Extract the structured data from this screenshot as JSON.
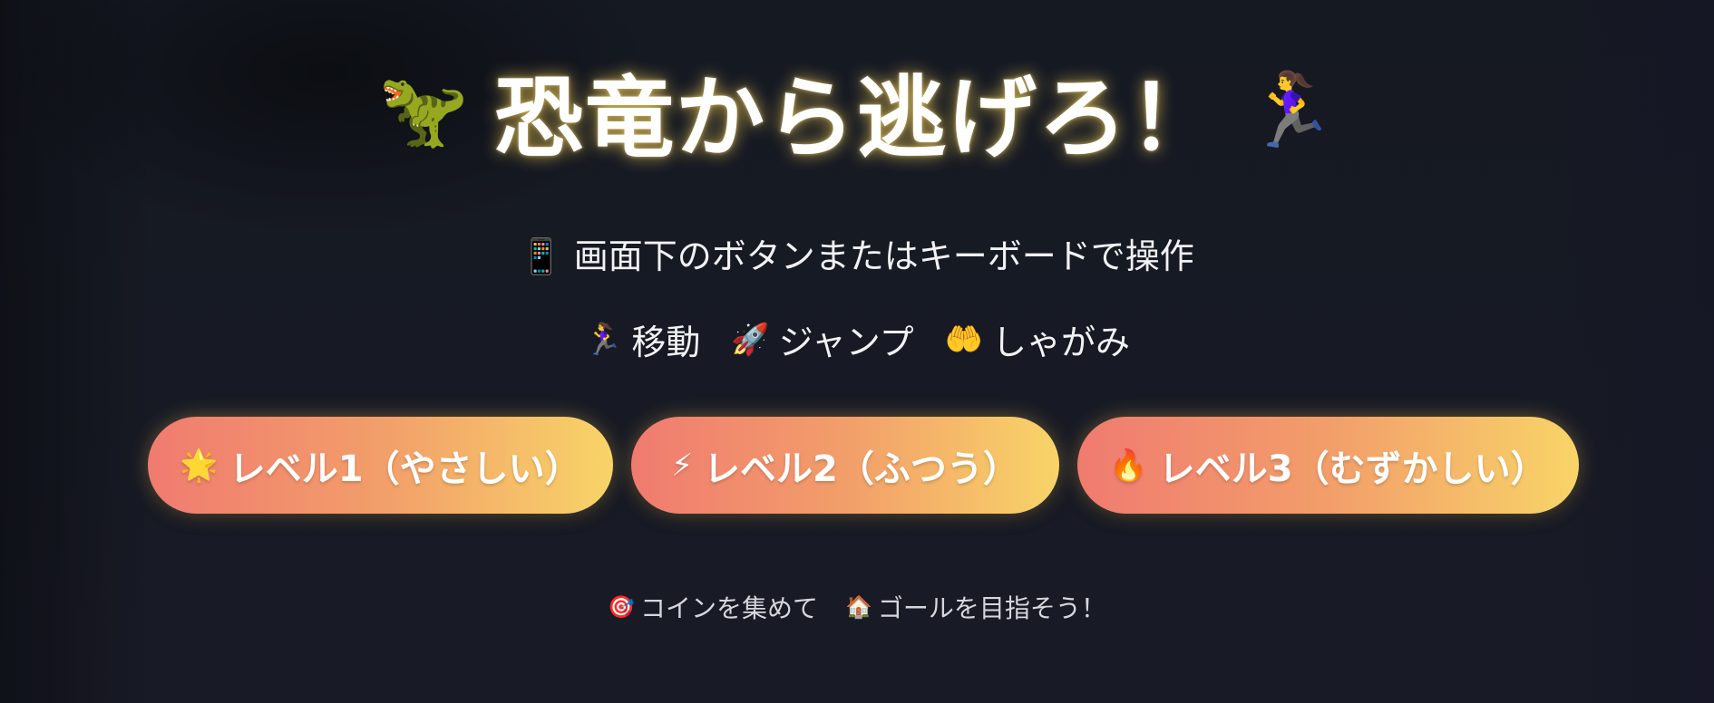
{
  "title": {
    "left_emoji": "🦖",
    "text": "恐竜から逃げろ！",
    "right_emoji": "🏃‍♀️"
  },
  "subtitle": "📱 画面下のボタンまたはキーボードで操作",
  "controls": [
    {
      "icon": "🏃‍♀️",
      "label": "移動"
    },
    {
      "icon": "🚀",
      "label": "ジャンプ"
    },
    {
      "icon": "🤲",
      "label": "しゃがみ"
    }
  ],
  "levels": [
    {
      "icon": "🌟",
      "label": "レベル1（やさしい）"
    },
    {
      "icon": "⚡",
      "label": "レベル2（ふつう）"
    },
    {
      "icon": "🔥",
      "label": "レベル3（むずかしい）"
    }
  ],
  "footer": [
    {
      "icon": "🎯",
      "text": "コインを集めて"
    },
    {
      "icon": "🏠",
      "text": "ゴールを目指そう！"
    }
  ],
  "colors": {
    "background": "#151821",
    "button_gradient_start": "#f07b70",
    "button_gradient_end": "#f8d468",
    "title_glow": "#ffd75a"
  }
}
